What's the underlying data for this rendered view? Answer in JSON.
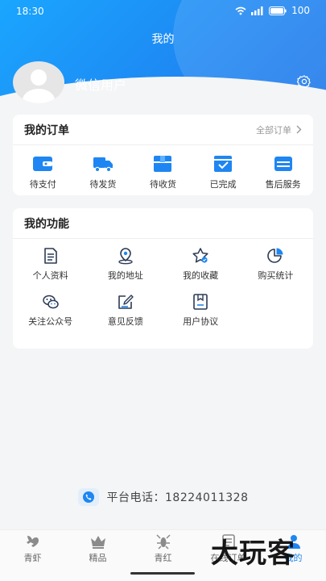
{
  "status": {
    "time": "18:30",
    "battery": "100"
  },
  "page_title": "我的",
  "user": {
    "name": "微信用户"
  },
  "orders": {
    "title": "我的订单",
    "all_label": "全部订单",
    "items": [
      {
        "label": "待支付",
        "icon": "wallet-icon"
      },
      {
        "label": "待发货",
        "icon": "truck-icon"
      },
      {
        "label": "待收货",
        "icon": "box-icon"
      },
      {
        "label": "已完成",
        "icon": "check-box-icon"
      },
      {
        "label": "售后服务",
        "icon": "service-icon"
      }
    ]
  },
  "functions": {
    "title": "我的功能",
    "items": [
      {
        "label": "个人资料",
        "icon": "document-icon"
      },
      {
        "label": "我的地址",
        "icon": "location-icon"
      },
      {
        "label": "我的收藏",
        "icon": "star-icon"
      },
      {
        "label": "购买统计",
        "icon": "pie-chart-icon"
      },
      {
        "label": "关注公众号",
        "icon": "wechat-icon"
      },
      {
        "label": "意见反馈",
        "icon": "edit-icon"
      },
      {
        "label": "用户协议",
        "icon": "agreement-icon"
      }
    ]
  },
  "contact": {
    "phone_text": "平台电话：18224011328"
  },
  "tabbar": {
    "items": [
      {
        "label": "青虾",
        "icon": "shrimp-icon"
      },
      {
        "label": "精品",
        "icon": "crown-icon"
      },
      {
        "label": "青红",
        "icon": "lobster-icon"
      },
      {
        "label": "在线订单",
        "icon": "order-icon"
      },
      {
        "label": "我的",
        "icon": "person-icon"
      }
    ]
  },
  "watermark": "大玩客",
  "colors": {
    "accent": "#1e86f2",
    "hero_start": "#1aa6ff",
    "hero_end": "#1a6fe6"
  }
}
